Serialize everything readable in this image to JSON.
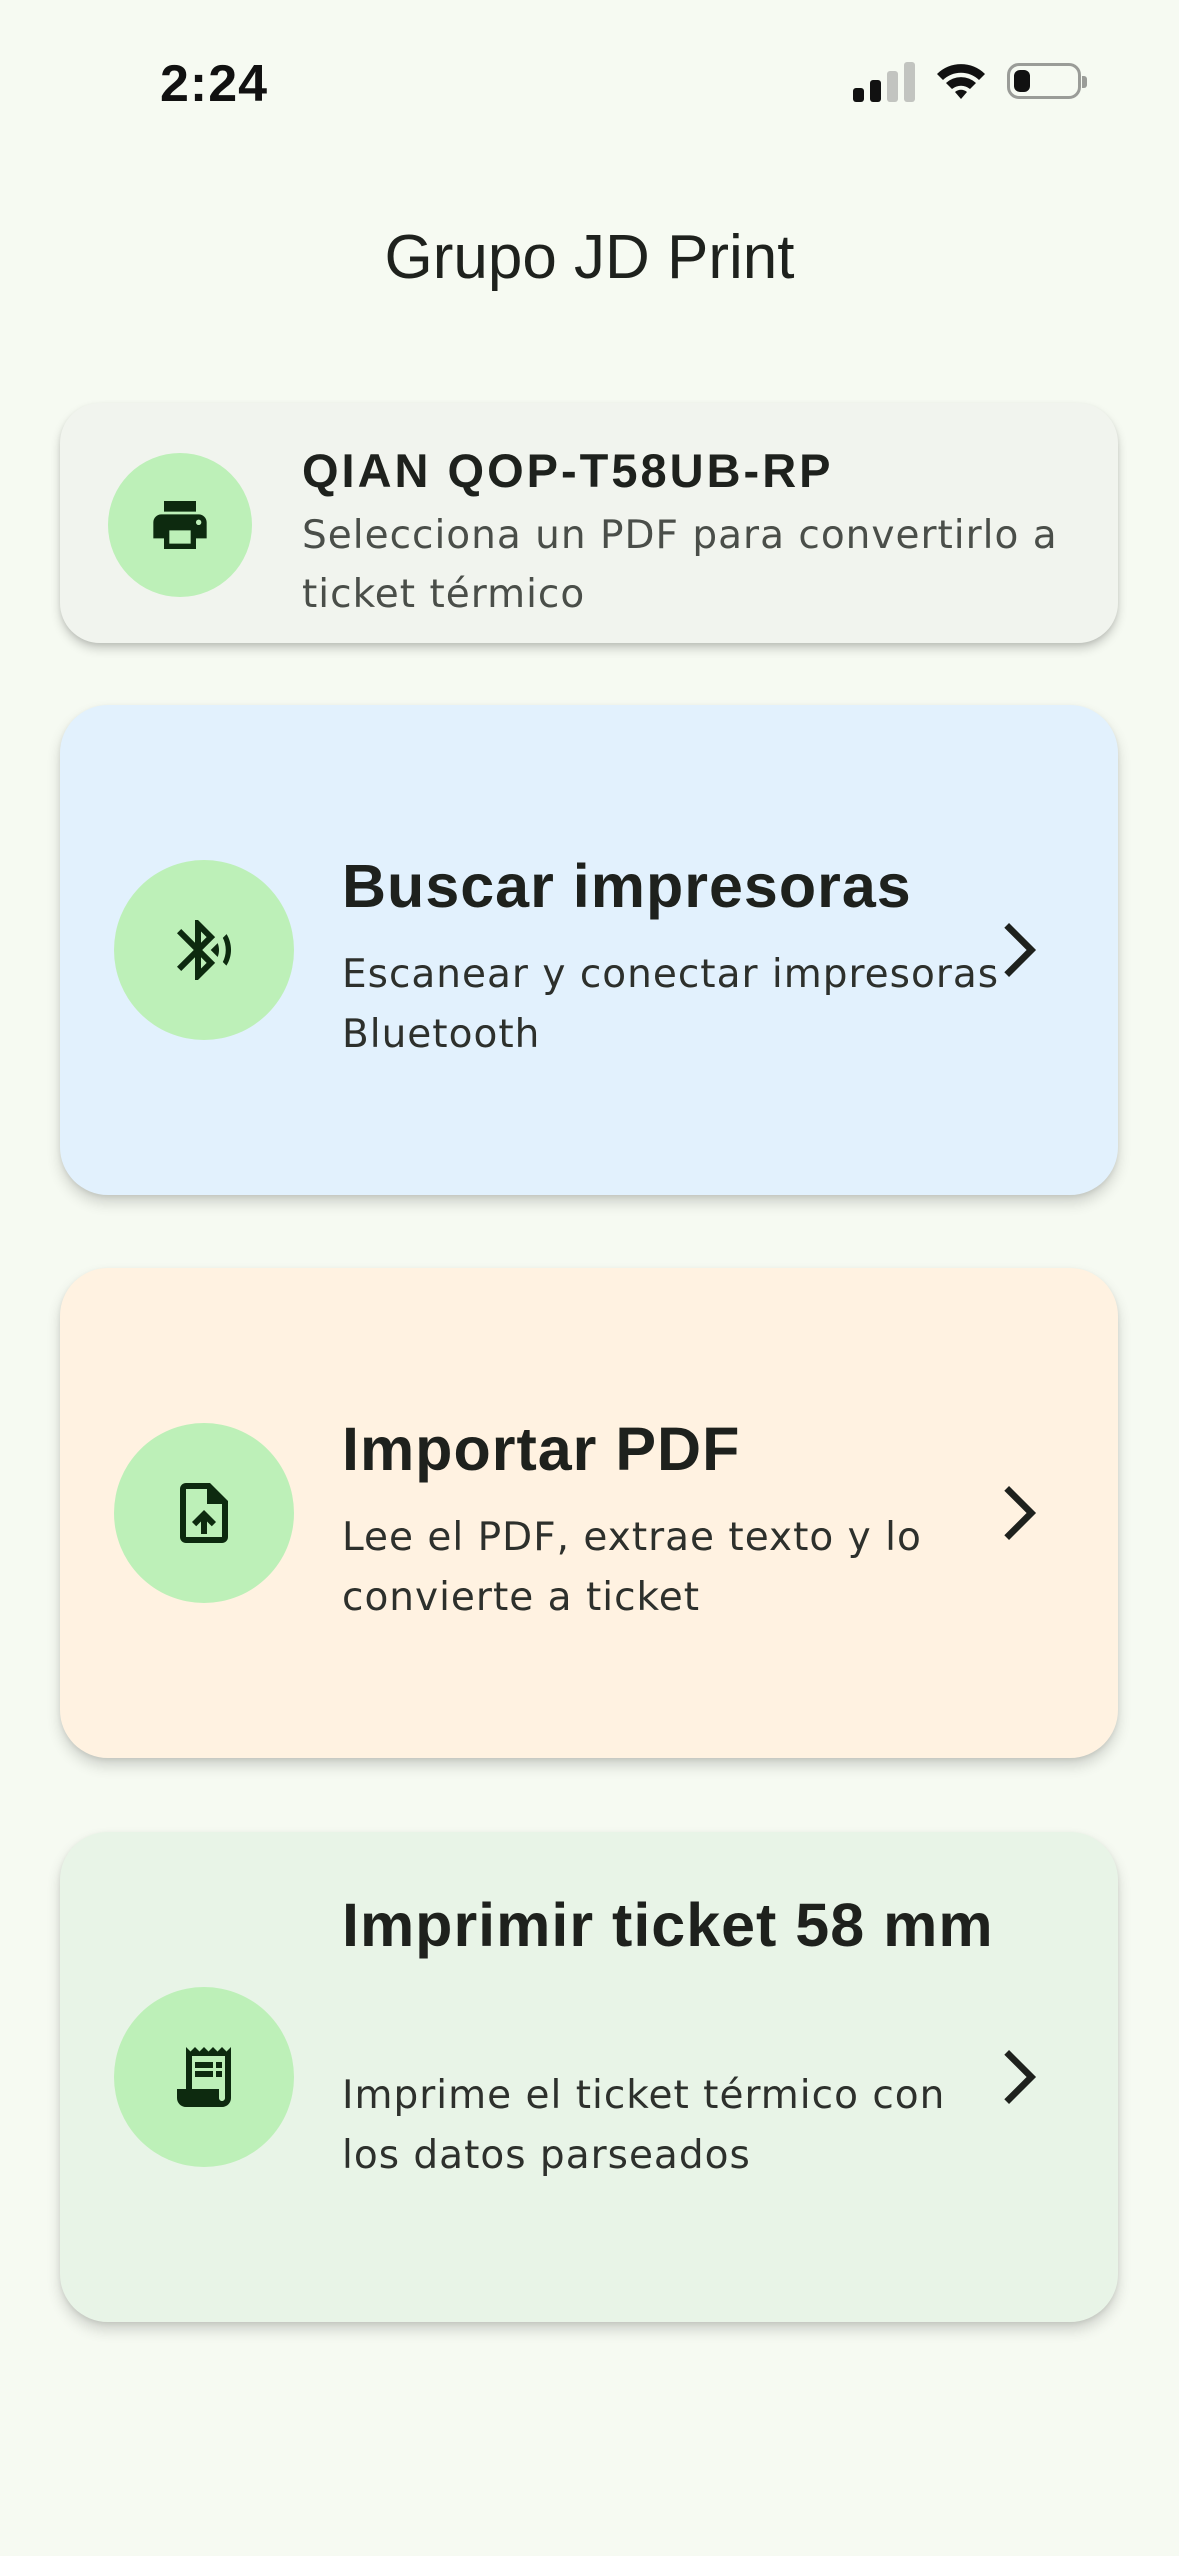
{
  "status_bar": {
    "time": "2:24"
  },
  "app": {
    "title": "Grupo JD Print"
  },
  "printer": {
    "name": "QIAN QOP-T58UB-RP",
    "description": "Selecciona un PDF para convertirlo a ticket térmico",
    "icon": "printer-icon"
  },
  "actions": [
    {
      "title": "Buscar impresoras",
      "description": "Escanear y conectar impresoras Bluetooth",
      "icon": "bluetooth-searching-icon",
      "background": "#e2f1fd"
    },
    {
      "title": "Importar PDF",
      "description": "Lee el PDF, extrae texto y lo convierte a ticket",
      "icon": "file-upload-icon",
      "background": "#fff2e1"
    },
    {
      "title": "Imprimir ticket 58 mm",
      "description": "Imprime el ticket térmico con los datos parseados",
      "icon": "receipt-icon",
      "background": "#e8f4e7"
    }
  ],
  "colors": {
    "page_background": "#f6faf2",
    "icon_circle": "#bdf0b8",
    "icon_glyph": "#0d2a0f"
  }
}
